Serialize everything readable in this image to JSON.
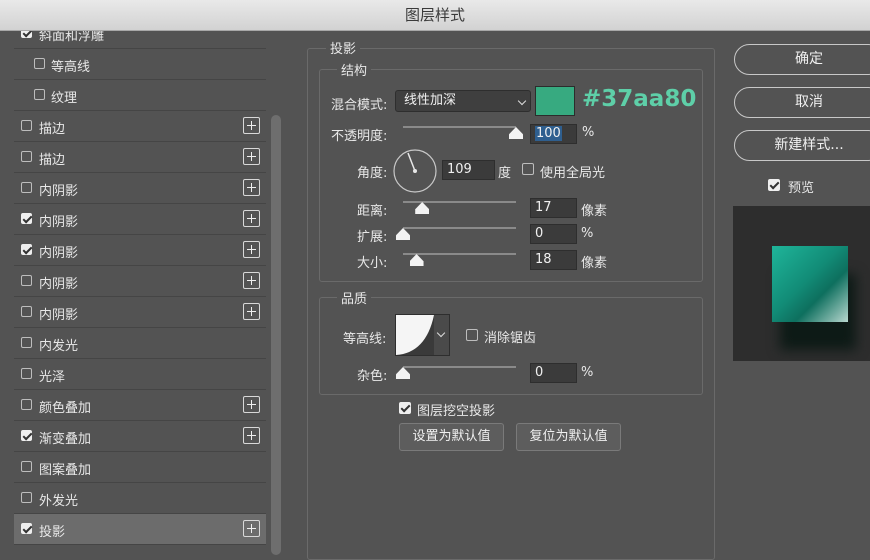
{
  "window": {
    "title": "图层样式"
  },
  "style_list": [
    {
      "label": "斜面和浮雕",
      "checked": true,
      "indent": false,
      "plus": false
    },
    {
      "label": "等高线",
      "checked": false,
      "indent": true,
      "plus": false
    },
    {
      "label": "纹理",
      "checked": false,
      "indent": true,
      "plus": false
    },
    {
      "label": "描边",
      "checked": false,
      "indent": false,
      "plus": true
    },
    {
      "label": "描边",
      "checked": false,
      "indent": false,
      "plus": true
    },
    {
      "label": "内阴影",
      "checked": false,
      "indent": false,
      "plus": true
    },
    {
      "label": "内阴影",
      "checked": true,
      "indent": false,
      "plus": true
    },
    {
      "label": "内阴影",
      "checked": true,
      "indent": false,
      "plus": true
    },
    {
      "label": "内阴影",
      "checked": false,
      "indent": false,
      "plus": true
    },
    {
      "label": "内阴影",
      "checked": false,
      "indent": false,
      "plus": true
    },
    {
      "label": "内发光",
      "checked": false,
      "indent": false,
      "plus": false
    },
    {
      "label": "光泽",
      "checked": false,
      "indent": false,
      "plus": false
    },
    {
      "label": "颜色叠加",
      "checked": false,
      "indent": false,
      "plus": true
    },
    {
      "label": "渐变叠加",
      "checked": true,
      "indent": false,
      "plus": true
    },
    {
      "label": "图案叠加",
      "checked": false,
      "indent": false,
      "plus": false
    },
    {
      "label": "外发光",
      "checked": false,
      "indent": false,
      "plus": false
    },
    {
      "label": "投影",
      "checked": true,
      "indent": false,
      "plus": true,
      "selected": true
    }
  ],
  "drop_shadow": {
    "section_title": "投影",
    "structure": {
      "title": "结构",
      "blend_mode_label": "混合模式:",
      "blend_mode_value": "线性加深",
      "color": "#37aa80",
      "color_annotation": "#37aa80",
      "opacity_label": "不透明度:",
      "opacity_value": "100",
      "opacity_unit": "%",
      "opacity_level": 1.0,
      "angle_label": "角度:",
      "angle_value": "109",
      "angle_unit": "度",
      "global_light_label": "使用全局光",
      "global_light_checked": false,
      "distance_label": "距离:",
      "distance_value": "17",
      "distance_unit": "像素",
      "distance_level": 0.17,
      "spread_label": "扩展:",
      "spread_value": "0",
      "spread_unit": "%",
      "spread_level": 0.0,
      "size_label": "大小:",
      "size_value": "18",
      "size_unit": "像素",
      "size_level": 0.12
    },
    "quality": {
      "title": "品质",
      "contour_label": "等高线:",
      "anti_alias_label": "消除锯齿",
      "anti_alias_checked": false,
      "noise_label": "杂色:",
      "noise_value": "0",
      "noise_unit": "%",
      "noise_level": 0.0
    },
    "knockout_label": "图层挖空投影",
    "knockout_checked": true,
    "make_default_label": "设置为默认值",
    "reset_default_label": "复位为默认值"
  },
  "right": {
    "ok_label": "确定",
    "cancel_label": "取消",
    "new_style_label": "新建样式...",
    "preview_label": "预览",
    "preview_checked": true
  }
}
